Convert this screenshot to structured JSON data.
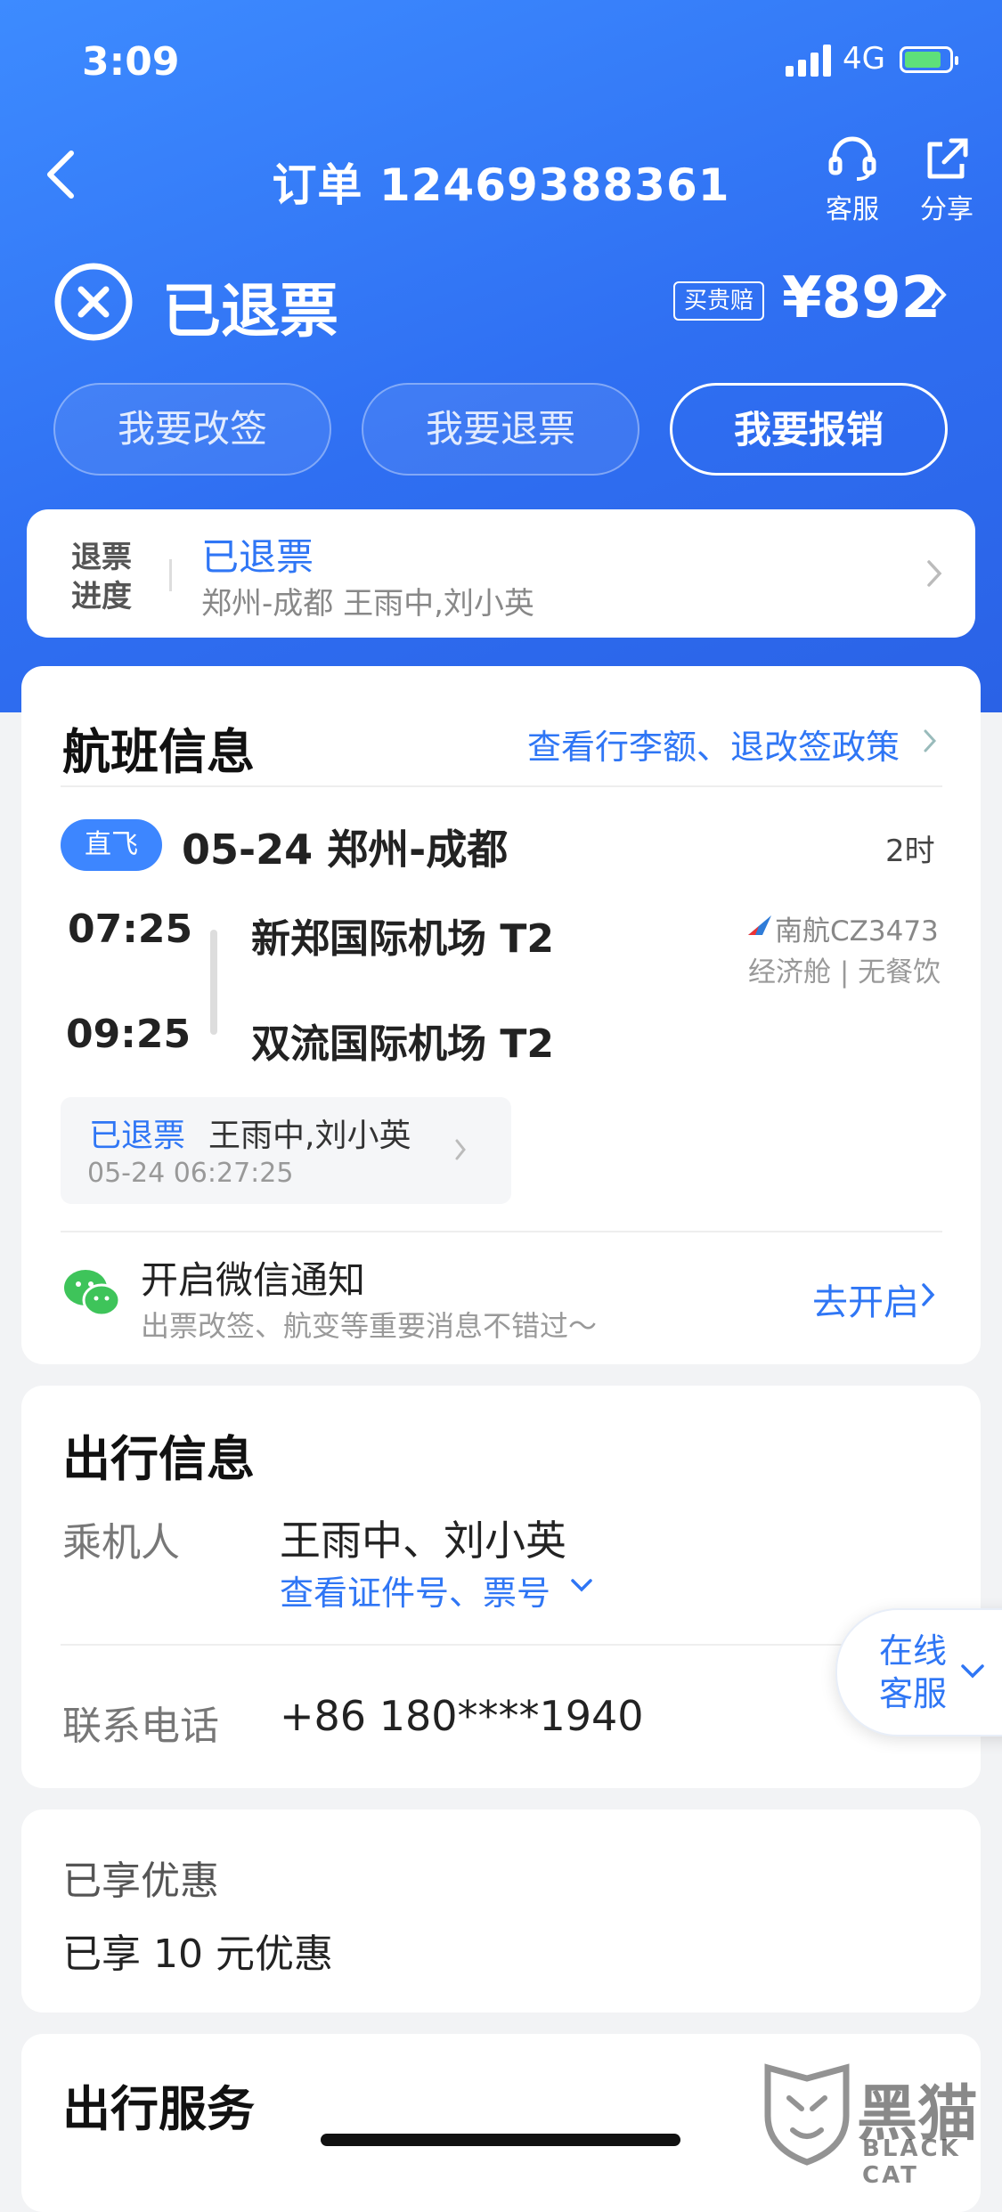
{
  "status_bar": {
    "time": "3:09",
    "network": "4G"
  },
  "nav": {
    "title": "订单 12469388361",
    "service_label": "客服",
    "share_label": "分享"
  },
  "order_status": {
    "text": "已退票",
    "tag": "买贵赔",
    "price": "¥892",
    "actions": [
      "我要改签",
      "我要退票",
      "我要报销"
    ]
  },
  "refund_progress": {
    "label": "退票进度",
    "status": "已退票",
    "detail": "郑州-成都 王雨中,刘小英"
  },
  "flight_info": {
    "title": "航班信息",
    "policy_link": "查看行李额、退改签政策",
    "badge": "直飞",
    "route": "05-24 郑州-成都",
    "duration": "2时",
    "depart_time": "07:25",
    "depart_airport": "新郑国际机场 T2",
    "arrive_time": "09:25",
    "arrive_airport": "双流国际机场 T2",
    "airline": "南航CZ3473",
    "cabin": "经济舱 | 无餐饮",
    "refund_status": "已退票",
    "refund_passengers": "王雨中,刘小英",
    "refund_time": "05-24 06:27:25",
    "wechat_title": "开启微信通知",
    "wechat_sub": "出票改签、航变等重要消息不错过～",
    "wechat_action": "去开启"
  },
  "travel_info": {
    "title": "出行信息",
    "passenger_label": "乘机人",
    "passengers": "王雨中、刘小英",
    "view_ids": "查看证件号、票号",
    "phone_label": "联系电话",
    "phone": "+86 180****1940"
  },
  "online_service": {
    "line1": "在线",
    "line2": "客服"
  },
  "discount": {
    "title": "已享优惠",
    "value": "已享 10 元优惠"
  },
  "services": {
    "title": "出行服务"
  },
  "watermark": {
    "text": "黑猫",
    "sub": "BLACK CAT"
  },
  "colors": {
    "accent": "#2f76f5",
    "header": "#3d8bff",
    "badge": "#3d86ff"
  }
}
